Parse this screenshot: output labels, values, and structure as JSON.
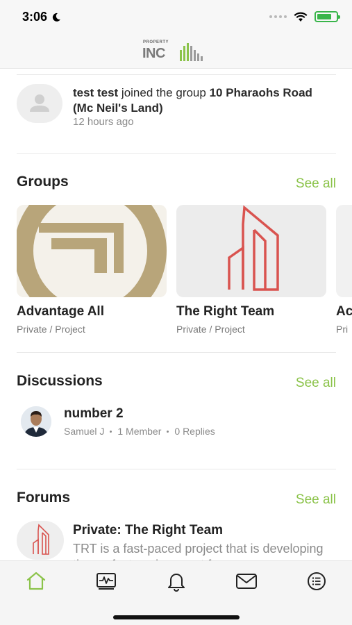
{
  "status_bar": {
    "time": "3:06"
  },
  "header": {
    "logo_small": "PROPERTY",
    "logo_main": "INC"
  },
  "activity": {
    "user": "test test",
    "action": " joined the group ",
    "group": "10 Pharaohs Road (Mc Neil's Land)",
    "time": "12 hours ago"
  },
  "groups": {
    "title": "Groups",
    "see_all": "See all",
    "items": [
      {
        "name": "Advantage All",
        "meta": "Private / Project"
      },
      {
        "name": "The Right Team",
        "meta": "Private / Project"
      },
      {
        "name": "Ac",
        "meta": "Pri"
      }
    ]
  },
  "discussions": {
    "title": "Discussions",
    "see_all": "See all",
    "item": {
      "title": "number 2",
      "author": "Samuel J",
      "members": "1 Member",
      "replies": "0 Replies"
    }
  },
  "forums": {
    "title": "Forums",
    "see_all": "See all",
    "item": {
      "title": "Private: The Right Team",
      "description": "TRT is a fast-paced project that is developing the perfect environment f"
    }
  },
  "tabs": [
    "home-icon",
    "activity-icon",
    "bell-icon",
    "mail-icon",
    "menu-icon"
  ],
  "colors": {
    "accent": "#8bc34a",
    "logo_red": "#d9534f",
    "gold": "#b8a57a"
  }
}
